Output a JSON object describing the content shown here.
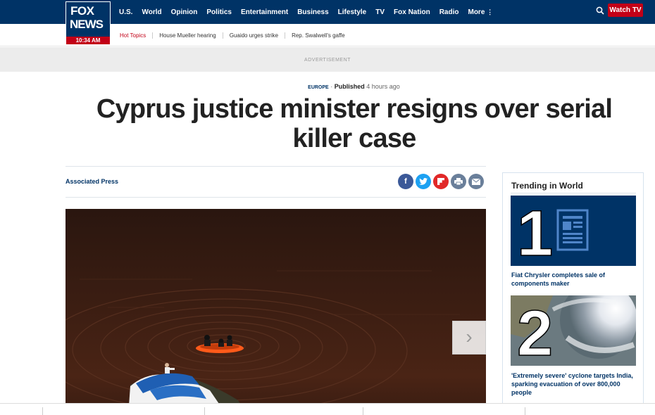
{
  "header": {
    "logo": {
      "line1": "FOX",
      "line2": "NEWS",
      "time": "10:34 AM"
    },
    "nav": [
      "U.S.",
      "World",
      "Opinion",
      "Politics",
      "Entertainment",
      "Business",
      "Lifestyle",
      "TV",
      "Fox Nation",
      "Radio",
      "More"
    ],
    "more_icon": "⋮",
    "search_icon": "search-icon",
    "watch_tv": "Watch TV",
    "hot_topics_label": "Hot Topics",
    "hot_topics": [
      "House Mueller hearing",
      "Guaido urges strike",
      "Rep. Swalwell's gaffe"
    ]
  },
  "advertisement_label": "ADVERTISEMENT",
  "article": {
    "category": "EUROPE",
    "separator": "·",
    "published_label": "Published",
    "published_time": "4 hours ago",
    "headline": "Cyprus justice minister resigns over serial killer case",
    "byline": "Associated Press",
    "share": [
      {
        "name": "facebook",
        "glyph": "f",
        "color": "#3b5998"
      },
      {
        "name": "twitter",
        "glyph": "t",
        "color": "#1da1f2"
      },
      {
        "name": "flipboard",
        "glyph": "F",
        "color": "#e12828"
      },
      {
        "name": "print",
        "glyph": "⎙",
        "color": "#6a7f9a"
      },
      {
        "name": "email",
        "glyph": "✉",
        "color": "#6a7f9a"
      }
    ],
    "gallery_next": "›"
  },
  "trending": {
    "title": "Trending in World",
    "items": [
      {
        "rank": "1",
        "caption": "Fiat Chrysler completes sale of components maker"
      },
      {
        "rank": "2",
        "caption": "'Extremely severe' cyclone targets India, sparking evacuation of over 800,000 people"
      }
    ]
  },
  "colors": {
    "brand_navy": "#003366",
    "brand_red": "#c20017"
  }
}
